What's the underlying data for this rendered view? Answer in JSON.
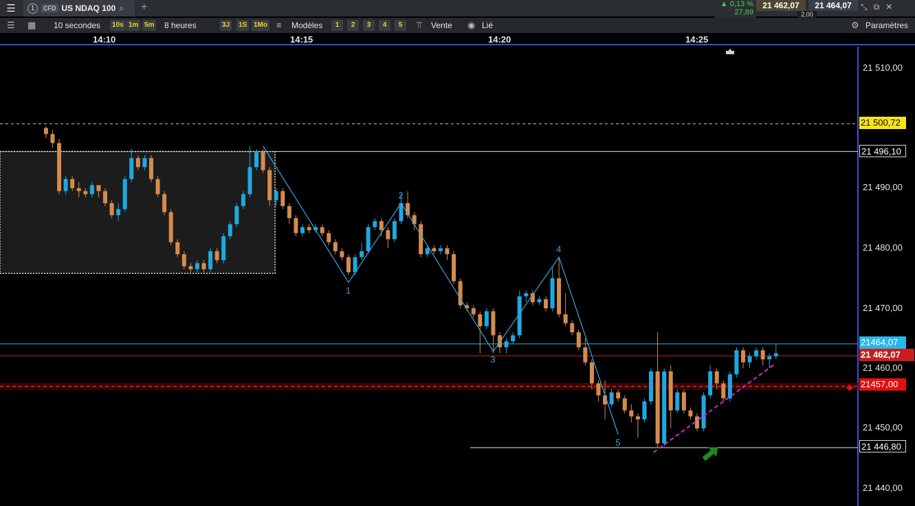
{
  "topbar": {
    "menu_icon": "hamburger-icon",
    "tab_number": "1",
    "cfd_badge": "CFD",
    "instrument": "US NDAQ 100",
    "change_pct": "0,13 %",
    "change_abs": "27,89",
    "sell_price": "21 462,07",
    "buy_price": "21 464,07",
    "spread": "2,00"
  },
  "toolbar": {
    "interval": "10 secondes",
    "intervals": [
      "10s",
      "1m",
      "5m"
    ],
    "range": "8 heures",
    "ranges": [
      "3J",
      "1S",
      "1Mo"
    ],
    "models_label": "Modèles",
    "model_slots": [
      "1",
      "2",
      "3",
      "4",
      "5"
    ],
    "sell_label": "Vente",
    "linked_label": "Lié",
    "settings_label": "Paramètres"
  },
  "time_labels": [
    "14:10",
    "14:15",
    "14:20",
    "14:25"
  ],
  "price_labels": [
    "21 510,00",
    "21 490,00",
    "21 480,00",
    "21 470,00",
    "21 460,00",
    "21 450,00",
    "21 440,00"
  ],
  "tags": {
    "dashed_level": "21 500,72",
    "resistance": "21 496,10",
    "ask": "21464,07",
    "bid": "21 462,07",
    "order": "21457,00",
    "support": "21 446,80"
  },
  "wave_labels": [
    "1",
    "2",
    "3",
    "4",
    "5"
  ],
  "colors": {
    "bull": "#1fa8e0",
    "bear": "#d58b4e",
    "wave": "#3aa3dc",
    "order": "#e01010",
    "trendline": "#d42ad4",
    "arrow": "#1f8a1f",
    "ask_tag": "#29b6e8",
    "bid_tag": "#c81e1e",
    "dashed_tag": "#f7e21a"
  },
  "chart_data": {
    "type": "candlestick",
    "ylim": [
      21437,
      21515
    ],
    "candles": [
      {
        "t": "14:08:30",
        "o": 21500.0,
        "h": 21500.3,
        "l": 21498.3,
        "c": 21499.0
      },
      {
        "t": "14:08:40",
        "o": 21499.0,
        "h": 21499.7,
        "l": 21496.7,
        "c": 21497.5
      },
      {
        "t": "14:08:50",
        "o": 21497.5,
        "h": 21498.2,
        "l": 21489.0,
        "c": 21489.5
      },
      {
        "t": "14:09:00",
        "o": 21489.5,
        "h": 21492.0,
        "l": 21489.0,
        "c": 21491.5
      },
      {
        "t": "14:09:10",
        "o": 21491.5,
        "h": 21492.0,
        "l": 21489.5,
        "c": 21490.0
      },
      {
        "t": "14:09:20",
        "o": 21490.0,
        "h": 21491.0,
        "l": 21488.5,
        "c": 21489.5
      },
      {
        "t": "14:09:30",
        "o": 21489.5,
        "h": 21490.0,
        "l": 21488.5,
        "c": 21489.0
      },
      {
        "t": "14:09:40",
        "o": 21489.0,
        "h": 21491.0,
        "l": 21488.5,
        "c": 21490.5
      },
      {
        "t": "14:09:50",
        "o": 21490.5,
        "h": 21490.5,
        "l": 21488.5,
        "c": 21489.5
      },
      {
        "t": "14:10:00",
        "o": 21489.5,
        "h": 21490.0,
        "l": 21487.0,
        "c": 21487.5
      },
      {
        "t": "14:10:10",
        "o": 21487.5,
        "h": 21488.0,
        "l": 21485.0,
        "c": 21485.5
      },
      {
        "t": "14:10:20",
        "o": 21485.5,
        "h": 21487.5,
        "l": 21484.5,
        "c": 21486.5
      },
      {
        "t": "14:10:30",
        "o": 21486.5,
        "h": 21492.0,
        "l": 21486.0,
        "c": 21491.5
      },
      {
        "t": "14:10:40",
        "o": 21491.5,
        "h": 21496.5,
        "l": 21491.0,
        "c": 21495.0
      },
      {
        "t": "14:10:50",
        "o": 21495.0,
        "h": 21495.5,
        "l": 21493.0,
        "c": 21493.5
      },
      {
        "t": "14:11:00",
        "o": 21493.5,
        "h": 21495.5,
        "l": 21493.0,
        "c": 21495.0
      },
      {
        "t": "14:11:10",
        "o": 21495.0,
        "h": 21495.5,
        "l": 21491.0,
        "c": 21491.5
      },
      {
        "t": "14:11:20",
        "o": 21491.5,
        "h": 21492.0,
        "l": 21488.5,
        "c": 21489.0
      },
      {
        "t": "14:11:30",
        "o": 21489.0,
        "h": 21489.5,
        "l": 21485.5,
        "c": 21486.0
      },
      {
        "t": "14:11:40",
        "o": 21486.0,
        "h": 21486.5,
        "l": 21480.5,
        "c": 21481.0
      },
      {
        "t": "14:11:50",
        "o": 21481.0,
        "h": 21481.5,
        "l": 21478.5,
        "c": 21479.0
      },
      {
        "t": "14:12:00",
        "o": 21479.0,
        "h": 21479.5,
        "l": 21476.5,
        "c": 21477.0
      },
      {
        "t": "14:12:10",
        "o": 21477.0,
        "h": 21477.5,
        "l": 21476.0,
        "c": 21476.5
      },
      {
        "t": "14:12:20",
        "o": 21476.5,
        "h": 21478.0,
        "l": 21476.0,
        "c": 21477.5
      },
      {
        "t": "14:12:30",
        "o": 21477.5,
        "h": 21478.0,
        "l": 21476.0,
        "c": 21476.5
      },
      {
        "t": "14:12:40",
        "o": 21476.5,
        "h": 21480.0,
        "l": 21476.0,
        "c": 21479.5
      },
      {
        "t": "14:12:50",
        "o": 21479.5,
        "h": 21480.0,
        "l": 21477.5,
        "c": 21478.0
      },
      {
        "t": "14:13:00",
        "o": 21478.0,
        "h": 21482.5,
        "l": 21477.5,
        "c": 21482.0
      },
      {
        "t": "14:13:10",
        "o": 21482.0,
        "h": 21484.5,
        "l": 21481.5,
        "c": 21484.0
      },
      {
        "t": "14:13:20",
        "o": 21484.0,
        "h": 21487.5,
        "l": 21483.5,
        "c": 21487.0
      },
      {
        "t": "14:13:30",
        "o": 21487.0,
        "h": 21489.5,
        "l": 21486.5,
        "c": 21489.0
      },
      {
        "t": "14:13:40",
        "o": 21489.0,
        "h": 21497.0,
        "l": 21488.5,
        "c": 21493.5
      },
      {
        "t": "14:13:50",
        "o": 21493.5,
        "h": 21496.5,
        "l": 21493.0,
        "c": 21496.0
      },
      {
        "t": "14:14:00",
        "o": 21496.0,
        "h": 21496.5,
        "l": 21492.5,
        "c": 21493.0
      },
      {
        "t": "14:14:10",
        "o": 21493.0,
        "h": 21493.5,
        "l": 21487.0,
        "c": 21488.0
      },
      {
        "t": "14:14:20",
        "o": 21488.0,
        "h": 21490.0,
        "l": 21487.0,
        "c": 21489.5
      },
      {
        "t": "14:14:30",
        "o": 21489.5,
        "h": 21490.0,
        "l": 21486.5,
        "c": 21487.0
      },
      {
        "t": "14:14:40",
        "o": 21487.0,
        "h": 21487.5,
        "l": 21484.0,
        "c": 21485.0
      },
      {
        "t": "14:14:50",
        "o": 21485.0,
        "h": 21485.5,
        "l": 21482.0,
        "c": 21482.5
      },
      {
        "t": "14:15:00",
        "o": 21482.5,
        "h": 21484.0,
        "l": 21482.0,
        "c": 21483.5
      },
      {
        "t": "14:15:10",
        "o": 21483.5,
        "h": 21484.0,
        "l": 21482.5,
        "c": 21483.0
      },
      {
        "t": "14:15:20",
        "o": 21483.0,
        "h": 21484.0,
        "l": 21482.5,
        "c": 21483.5
      },
      {
        "t": "14:15:30",
        "o": 21483.5,
        "h": 21484.0,
        "l": 21482.0,
        "c": 21482.5
      },
      {
        "t": "14:15:40",
        "o": 21482.5,
        "h": 21483.0,
        "l": 21480.5,
        "c": 21481.0
      },
      {
        "t": "14:15:50",
        "o": 21481.0,
        "h": 21481.5,
        "l": 21479.0,
        "c": 21479.5
      },
      {
        "t": "14:16:00",
        "o": 21479.5,
        "h": 21480.0,
        "l": 21478.0,
        "c": 21478.5
      },
      {
        "t": "14:16:10",
        "o": 21478.5,
        "h": 21479.0,
        "l": 21475.5,
        "c": 21476.0
      },
      {
        "t": "14:16:20",
        "o": 21476.0,
        "h": 21479.0,
        "l": 21475.5,
        "c": 21478.5
      },
      {
        "t": "14:16:30",
        "o": 21478.5,
        "h": 21481.0,
        "l": 21478.0,
        "c": 21479.5
      },
      {
        "t": "14:16:40",
        "o": 21479.5,
        "h": 21484.0,
        "l": 21479.0,
        "c": 21483.5
      },
      {
        "t": "14:16:50",
        "o": 21483.5,
        "h": 21485.0,
        "l": 21483.0,
        "c": 21484.5
      },
      {
        "t": "14:17:00",
        "o": 21484.5,
        "h": 21485.0,
        "l": 21482.0,
        "c": 21483.0
      },
      {
        "t": "14:17:10",
        "o": 21483.0,
        "h": 21483.5,
        "l": 21480.0,
        "c": 21481.5
      },
      {
        "t": "14:17:20",
        "o": 21481.5,
        "h": 21485.0,
        "l": 21481.0,
        "c": 21484.5
      },
      {
        "t": "14:17:30",
        "o": 21484.5,
        "h": 21489.0,
        "l": 21484.0,
        "c": 21487.5
      },
      {
        "t": "14:17:40",
        "o": 21487.5,
        "h": 21489.5,
        "l": 21485.0,
        "c": 21485.5
      },
      {
        "t": "14:17:50",
        "o": 21485.5,
        "h": 21486.0,
        "l": 21483.0,
        "c": 21484.0
      },
      {
        "t": "14:18:00",
        "o": 21484.0,
        "h": 21484.5,
        "l": 21478.5,
        "c": 21479.0
      },
      {
        "t": "14:18:10",
        "o": 21479.0,
        "h": 21480.5,
        "l": 21478.5,
        "c": 21480.0
      },
      {
        "t": "14:18:20",
        "o": 21480.0,
        "h": 21480.5,
        "l": 21479.0,
        "c": 21479.5
      },
      {
        "t": "14:18:30",
        "o": 21479.5,
        "h": 21480.5,
        "l": 21479.0,
        "c": 21480.0
      },
      {
        "t": "14:18:40",
        "o": 21480.0,
        "h": 21480.5,
        "l": 21478.0,
        "c": 21479.0
      },
      {
        "t": "14:18:50",
        "o": 21479.0,
        "h": 21479.5,
        "l": 21474.0,
        "c": 21474.5
      },
      {
        "t": "14:19:00",
        "o": 21474.5,
        "h": 21475.0,
        "l": 21470.0,
        "c": 21470.5
      },
      {
        "t": "14:19:10",
        "o": 21470.5,
        "h": 21471.0,
        "l": 21469.5,
        "c": 21470.0
      },
      {
        "t": "14:19:20",
        "o": 21470.0,
        "h": 21470.5,
        "l": 21468.5,
        "c": 21469.0
      },
      {
        "t": "14:19:30",
        "o": 21469.0,
        "h": 21469.5,
        "l": 21462.5,
        "c": 21467.0
      },
      {
        "t": "14:19:40",
        "o": 21467.0,
        "h": 21470.0,
        "l": 21466.5,
        "c": 21469.5
      },
      {
        "t": "14:19:50",
        "o": 21469.5,
        "h": 21470.0,
        "l": 21462.5,
        "c": 21465.5
      },
      {
        "t": "14:20:00",
        "o": 21465.5,
        "h": 21466.0,
        "l": 21462.5,
        "c": 21463.5
      },
      {
        "t": "14:20:10",
        "o": 21463.5,
        "h": 21465.0,
        "l": 21462.5,
        "c": 21464.5
      },
      {
        "t": "14:20:20",
        "o": 21464.5,
        "h": 21466.0,
        "l": 21464.0,
        "c": 21465.5
      },
      {
        "t": "14:20:30",
        "o": 21465.5,
        "h": 21473.0,
        "l": 21465.0,
        "c": 21472.0
      },
      {
        "t": "14:20:40",
        "o": 21472.0,
        "h": 21473.0,
        "l": 21471.0,
        "c": 21472.5
      },
      {
        "t": "14:20:50",
        "o": 21472.5,
        "h": 21473.0,
        "l": 21470.5,
        "c": 21471.0
      },
      {
        "t": "14:21:00",
        "o": 21471.0,
        "h": 21472.0,
        "l": 21470.5,
        "c": 21471.5
      },
      {
        "t": "14:21:10",
        "o": 21471.5,
        "h": 21472.0,
        "l": 21469.5,
        "c": 21470.0
      },
      {
        "t": "14:21:20",
        "o": 21470.0,
        "h": 21477.0,
        "l": 21469.5,
        "c": 21475.0
      },
      {
        "t": "14:21:30",
        "o": 21475.0,
        "h": 21478.5,
        "l": 21468.5,
        "c": 21469.0
      },
      {
        "t": "14:21:40",
        "o": 21469.0,
        "h": 21472.5,
        "l": 21467.0,
        "c": 21467.5
      },
      {
        "t": "14:21:50",
        "o": 21467.5,
        "h": 21468.0,
        "l": 21465.5,
        "c": 21466.0
      },
      {
        "t": "14:22:00",
        "o": 21466.0,
        "h": 21466.5,
        "l": 21463.0,
        "c": 21463.5
      },
      {
        "t": "14:22:10",
        "o": 21463.5,
        "h": 21465.0,
        "l": 21460.5,
        "c": 21461.0
      },
      {
        "t": "14:22:20",
        "o": 21461.0,
        "h": 21461.5,
        "l": 21456.5,
        "c": 21457.5
      },
      {
        "t": "14:22:30",
        "o": 21457.5,
        "h": 21458.0,
        "l": 21454.5,
        "c": 21455.5
      },
      {
        "t": "14:22:40",
        "o": 21455.5,
        "h": 21458.0,
        "l": 21451.5,
        "c": 21454.0
      },
      {
        "t": "14:22:50",
        "o": 21454.0,
        "h": 21456.5,
        "l": 21453.5,
        "c": 21456.0
      },
      {
        "t": "14:23:00",
        "o": 21456.0,
        "h": 21456.5,
        "l": 21454.5,
        "c": 21455.0
      },
      {
        "t": "14:23:10",
        "o": 21455.0,
        "h": 21455.5,
        "l": 21452.5,
        "c": 21453.0
      },
      {
        "t": "14:23:20",
        "o": 21453.0,
        "h": 21454.0,
        "l": 21451.0,
        "c": 21452.0
      },
      {
        "t": "14:23:30",
        "o": 21452.0,
        "h": 21452.5,
        "l": 21448.5,
        "c": 21451.5
      },
      {
        "t": "14:23:40",
        "o": 21451.5,
        "h": 21455.0,
        "l": 21451.0,
        "c": 21454.5
      },
      {
        "t": "14:23:50",
        "o": 21454.5,
        "h": 21460.0,
        "l": 21454.0,
        "c": 21459.5
      },
      {
        "t": "14:24:00",
        "o": 21459.5,
        "h": 21466.0,
        "l": 21446.8,
        "c": 21447.5
      },
      {
        "t": "14:24:10",
        "o": 21447.5,
        "h": 21460.0,
        "l": 21447.0,
        "c": 21459.5
      },
      {
        "t": "14:24:20",
        "o": 21459.5,
        "h": 21460.5,
        "l": 21450.0,
        "c": 21453.0
      },
      {
        "t": "14:24:30",
        "o": 21453.0,
        "h": 21456.5,
        "l": 21452.5,
        "c": 21456.0
      },
      {
        "t": "14:24:40",
        "o": 21456.0,
        "h": 21456.5,
        "l": 21452.5,
        "c": 21453.0
      },
      {
        "t": "14:24:50",
        "o": 21453.0,
        "h": 21453.5,
        "l": 21451.5,
        "c": 21452.0
      },
      {
        "t": "14:25:00",
        "o": 21452.0,
        "h": 21452.5,
        "l": 21449.5,
        "c": 21450.0
      },
      {
        "t": "14:25:10",
        "o": 21450.0,
        "h": 21456.0,
        "l": 21449.5,
        "c": 21455.5
      },
      {
        "t": "14:25:20",
        "o": 21455.5,
        "h": 21460.5,
        "l": 21455.0,
        "c": 21459.5
      },
      {
        "t": "14:25:30",
        "o": 21459.5,
        "h": 21460.0,
        "l": 21456.5,
        "c": 21457.5
      },
      {
        "t": "14:25:40",
        "o": 21457.5,
        "h": 21458.0,
        "l": 21454.5,
        "c": 21455.0
      },
      {
        "t": "14:25:50",
        "o": 21455.0,
        "h": 21459.5,
        "l": 21454.5,
        "c": 21459.0
      },
      {
        "t": "14:26:00",
        "o": 21459.0,
        "h": 21463.5,
        "l": 21458.5,
        "c": 21463.0
      },
      {
        "t": "14:26:10",
        "o": 21463.0,
        "h": 21463.5,
        "l": 21460.0,
        "c": 21461.0
      },
      {
        "t": "14:26:20",
        "o": 21461.0,
        "h": 21462.5,
        "l": 21460.0,
        "c": 21462.0
      },
      {
        "t": "14:26:30",
        "o": 21462.0,
        "h": 21463.5,
        "l": 21461.5,
        "c": 21463.0
      },
      {
        "t": "14:26:40",
        "o": 21463.0,
        "h": 21463.5,
        "l": 21460.5,
        "c": 21461.5
      },
      {
        "t": "14:26:50",
        "o": 21461.5,
        "h": 21462.5,
        "l": 21460.0,
        "c": 21462.0
      },
      {
        "t": "14:27:00",
        "o": 21462.0,
        "h": 21464.0,
        "l": 21461.5,
        "c": 21462.5
      }
    ],
    "wave_points": [
      {
        "label": "",
        "t": "14:14:00",
        "p": 21497.0
      },
      {
        "label": "1",
        "t": "14:16:10",
        "p": 21474.3
      },
      {
        "label": "2",
        "t": "14:17:30",
        "p": 21487.5
      },
      {
        "label": "3",
        "t": "14:19:50",
        "p": 21462.8
      },
      {
        "label": "4",
        "t": "14:21:30",
        "p": 21478.5
      },
      {
        "label": "5",
        "t": "14:23:00",
        "p": 21449.0
      }
    ],
    "levels": {
      "dashed": 21500.72,
      "resistance": 21496.1,
      "ask": 21464.07,
      "bid": 21462.07,
      "order": 21457.0,
      "support": 21446.8
    }
  }
}
